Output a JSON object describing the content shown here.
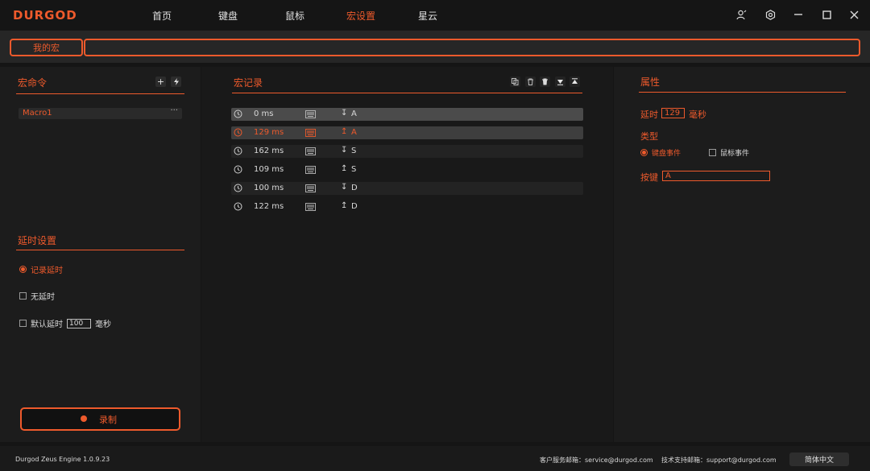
{
  "app": {
    "logo": "DURGOD"
  },
  "nav": [
    {
      "label": "首页",
      "active": false
    },
    {
      "label": "键盘",
      "active": false
    },
    {
      "label": "鼠标",
      "active": false
    },
    {
      "label": "宏设置",
      "active": true
    },
    {
      "label": "星云",
      "active": false
    }
  ],
  "window_icons": [
    "user-icon",
    "gear-icon",
    "minimize-icon",
    "maximize-icon",
    "close-icon"
  ],
  "tabbar": {
    "my_macro": "我的宏",
    "macro_name_value": ""
  },
  "macro_commands": {
    "title": "宏命令",
    "add_icon": "plus-icon",
    "import_icon": "lightning-icon",
    "items": [
      {
        "label": "Macro1",
        "more": "···"
      }
    ]
  },
  "delay_settings": {
    "title": "延时设置",
    "options": [
      {
        "label": "记录延时",
        "selected": true,
        "kind": "radio"
      },
      {
        "label": "无延时",
        "selected": false,
        "kind": "check"
      },
      {
        "label": "默认延时",
        "selected": false,
        "kind": "check",
        "value": "100",
        "unit": "毫秒"
      }
    ]
  },
  "record_button": {
    "label": "录制"
  },
  "macro_records": {
    "title": "宏记录",
    "toolbar_icons": [
      "copy-icon",
      "delete-icon",
      "trash-all-icon",
      "move-down-icon",
      "move-up-icon"
    ],
    "rows": [
      {
        "ms": "0 ms",
        "dir": "↧",
        "key": "A",
        "state": "sel"
      },
      {
        "ms": "129 ms",
        "dir": "↥",
        "key": "A",
        "state": "sel2-orange"
      },
      {
        "ms": "162 ms",
        "dir": "↧",
        "key": "S",
        "state": "alt"
      },
      {
        "ms": "109 ms",
        "dir": "↥",
        "key": "S",
        "state": "plain"
      },
      {
        "ms": "100 ms",
        "dir": "↧",
        "key": "D",
        "state": "alt"
      },
      {
        "ms": "122 ms",
        "dir": "↥",
        "key": "D",
        "state": "plain"
      }
    ]
  },
  "properties": {
    "title": "属性",
    "delay_label": "延时",
    "delay_value": "129",
    "delay_unit": "毫秒",
    "type_label": "类型",
    "type_options": [
      {
        "label": "键盘事件",
        "selected": true
      },
      {
        "label": "鼠标事件",
        "selected": false
      }
    ],
    "key_label": "按键",
    "key_value": "A"
  },
  "footer": {
    "version": "Durgod Zeus Engine 1.0.9.23",
    "service_email": "客户服务邮箱：service@durgod.com",
    "support_email": "技术支持邮箱：support@durgod.com",
    "language": "简体中文"
  },
  "colors": {
    "accent": "#ee5a2c",
    "background": "#151515",
    "panel": "#1c1c1c"
  }
}
